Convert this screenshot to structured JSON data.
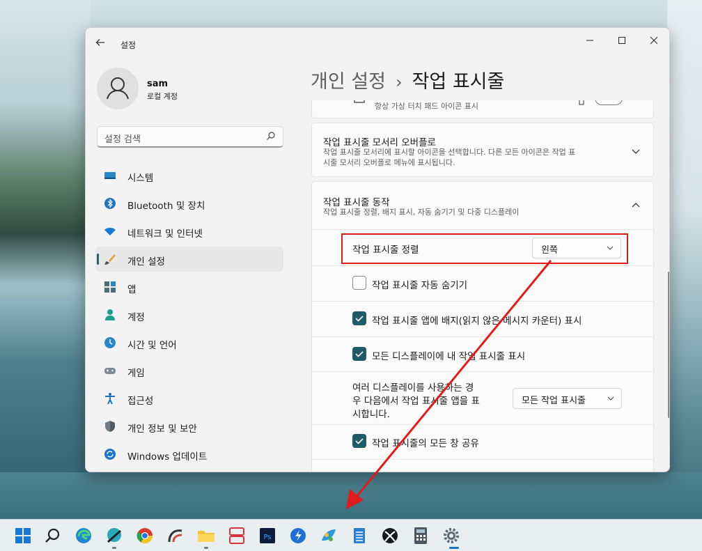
{
  "app": {
    "title": "설정",
    "window_controls": [
      "minimize",
      "maximize",
      "close"
    ]
  },
  "user": {
    "name": "sam",
    "account_type": "로컬 계정"
  },
  "search": {
    "placeholder": "설정 검색"
  },
  "sidebar": {
    "items": [
      {
        "label": "시스템",
        "icon": "system-icon"
      },
      {
        "label": "Bluetooth 및 장치",
        "icon": "bluetooth-icon"
      },
      {
        "label": "네트워크 및 인터넷",
        "icon": "network-icon"
      },
      {
        "label": "개인 설정",
        "icon": "personalization-brush-icon",
        "active": true
      },
      {
        "label": "앱",
        "icon": "apps-icon"
      },
      {
        "label": "계정",
        "icon": "accounts-icon"
      },
      {
        "label": "시간 및 언어",
        "icon": "time-language-icon"
      },
      {
        "label": "게임",
        "icon": "gaming-icon"
      },
      {
        "label": "접근성",
        "icon": "accessibility-icon"
      },
      {
        "label": "개인 정보 및 보안",
        "icon": "privacy-shield-icon"
      },
      {
        "label": "Windows 업데이트",
        "icon": "windows-update-icon"
      }
    ]
  },
  "breadcrumb": {
    "parent": "개인 설정",
    "separator": "›",
    "current": "작업 표시줄"
  },
  "main": {
    "partial_row": {
      "sub": "항상 가상 터치 패드 아이콘 표시"
    },
    "overflow": {
      "title": "작업 표시줄 모서리 오버플로",
      "sub_line1": "작업 표시줄 모서리에 표시할 아이콘을 선택합니다. 다른 모든 아이콘은 작업 표",
      "sub_line2": "시줄 모서리 오버플로 메뉴에 표시됩니다."
    },
    "behaviors": {
      "title": "작업 표시줄 동작",
      "sub": "작업 표시줄 정렬, 배지 표시, 자동 숨기기 및 다중 디스플레이",
      "alignment": {
        "label": "작업 표시줄 정렬",
        "value": "왼쪽"
      },
      "auto_hide": {
        "label": "작업 표시줄 자동 숨기기",
        "checked": false
      },
      "badges": {
        "label": "작업 표시줄 앱에 배지(읽지 않은 메시지 카운터) 표시",
        "checked": true
      },
      "all_displays": {
        "label": "모든 디스플레이에 내 작업 표시줄 표시",
        "checked": true
      },
      "multi_display": {
        "line1": "여러 디스플레이를 사용하는 경",
        "line2": "우 다음에서 작업 표시줄 앱을 표",
        "line3": "시합니다.",
        "value": "모든 작업 표시줄"
      },
      "share_window": {
        "label": "작업 표시줄의 모든 창 공유",
        "checked": true
      }
    }
  },
  "colors": {
    "accent": "#1f5b66",
    "annotation_red": "#e01b1b"
  },
  "taskbar": {
    "icons": [
      "windows-start-icon",
      "search-icon",
      "edge-icon",
      "app-icon",
      "chrome-icon",
      "app-icon",
      "file-explorer-icon",
      "app-icon",
      "photoshop-icon",
      "app-icon",
      "app-icon",
      "notepad-icon",
      "xbox-icon",
      "calculator-icon",
      "settings-icon"
    ]
  }
}
